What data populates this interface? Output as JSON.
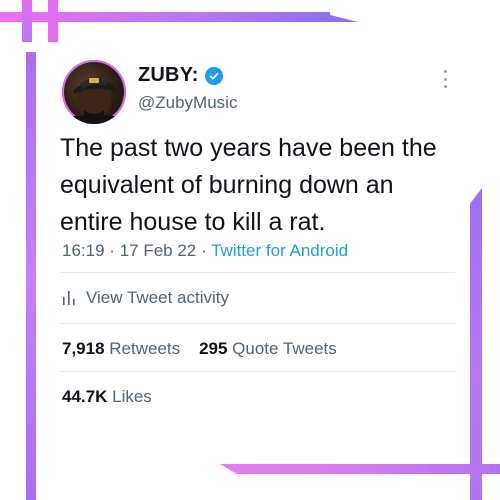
{
  "tweet": {
    "author_name": "ZUBY:",
    "handle": "@ZubyMusic",
    "text": "The past two years have been the equivalent of burning down an entire house to kill a rat.",
    "time": "16:19",
    "date": "17 Feb 22",
    "source": "Twitter for Android",
    "separator": "·"
  },
  "activity": {
    "label": "View Tweet activity"
  },
  "stats": {
    "retweets_count": "7,918",
    "retweets_label": "Retweets",
    "quote_count": "295",
    "quote_label": "Quote Tweets",
    "likes_count": "44.7K",
    "likes_label": "Likes"
  },
  "icons": {
    "verified": "verified-badge-icon",
    "more": "more-vertical-icon",
    "activity": "bar-chart-icon"
  },
  "colors": {
    "link": "#1d9bf0",
    "secondary_text": "#536471",
    "frame_pink": "#f06cf2",
    "frame_purple": "#a86ff4"
  }
}
